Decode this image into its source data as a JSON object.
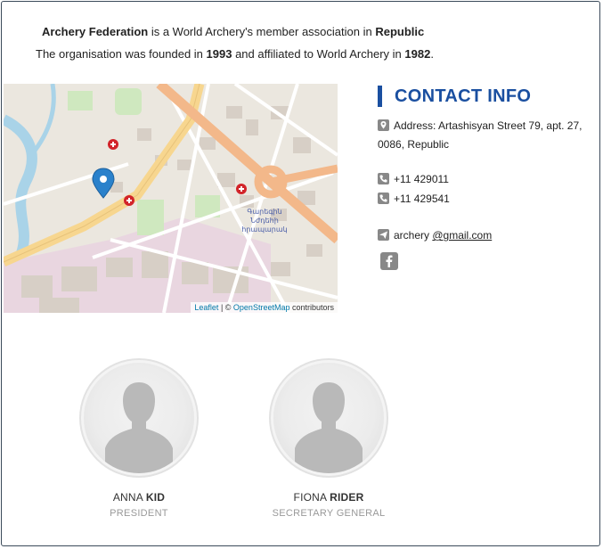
{
  "intro": {
    "federation_name": "Archery Federation",
    "line1_middle": "is a World Archery's member association in",
    "country": "Republic",
    "line2_prefix": "The organisation was founded in",
    "founded_year": "1993",
    "line2_middle": "and affiliated to World Archery in",
    "affiliated_year": "1982",
    "line2_suffix": "."
  },
  "map": {
    "attribution_leaflet": "Leaflet",
    "attribution_sep": " | © ",
    "attribution_osm": "OpenStreetMap",
    "attribution_suffix": " contributors"
  },
  "contact": {
    "title": "CONTACT INFO",
    "address": "Address: Artashisyan Street 79, apt. 27, 0086, Republic",
    "phone1": "+11 429011",
    "phone2": "+11 429541",
    "email_prefix": "archery ",
    "email_domain": "@gmail.com",
    "icons": [
      "map-marker-icon",
      "phone-icon",
      "phone-icon",
      "send-icon",
      "facebook-icon"
    ]
  },
  "people": [
    {
      "first": "ANNA",
      "last": "KID",
      "role": "PRESIDENT"
    },
    {
      "first": "FIONA",
      "last": "RIDER",
      "role": "SECRETARY GENERAL"
    }
  ],
  "colors": {
    "accent": "#1a4fa0",
    "icon_gray": "#888888",
    "role_gray": "#999999"
  }
}
